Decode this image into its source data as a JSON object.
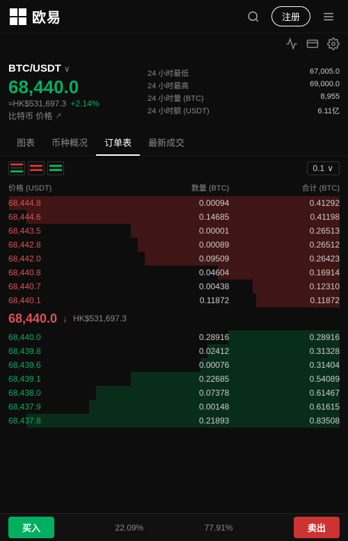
{
  "header": {
    "logo_text": "欧易",
    "register_label": "注册",
    "tabs": [
      "图表",
      "币种概况",
      "订单表",
      "最新成交"
    ],
    "active_tab": "订单表"
  },
  "pair": {
    "name": "BTC/USDT",
    "big_price": "68,440.0",
    "hk_price": "≈HK$531,697.3",
    "change": "+2.14%",
    "coin_label": "比特币 价格"
  },
  "stats": [
    {
      "label": "24 小时最低",
      "value": "67,005.0"
    },
    {
      "label": "24 小时最高",
      "value": "69,000.0"
    },
    {
      "label": "24 小时量 (BTC)",
      "value": "8,955"
    },
    {
      "label": "24 小时额 (USDT)",
      "value": "6.11亿"
    }
  ],
  "orderbook": {
    "decimal_selector": "0.1",
    "header": [
      "价格 (USDT)",
      "数量 (BTC)",
      "合计 (BTC)"
    ],
    "asks": [
      {
        "price": "68,444.8",
        "qty": "0.00094",
        "total": "0.41292",
        "bar_pct": 95
      },
      {
        "price": "68,444.6",
        "qty": "0.14685",
        "total": "0.41198",
        "bar_pct": 90
      },
      {
        "price": "68,443.5",
        "qty": "0.00001",
        "total": "0.26513",
        "bar_pct": 60
      },
      {
        "price": "68,442.8",
        "qty": "0.00089",
        "total": "0.26512",
        "bar_pct": 58
      },
      {
        "price": "68,442.0",
        "qty": "0.09509",
        "total": "0.26423",
        "bar_pct": 56
      },
      {
        "price": "68,440.8",
        "qty": "0.04604",
        "total": "0.16914",
        "bar_pct": 35
      },
      {
        "price": "68,440.7",
        "qty": "0.00438",
        "total": "0.12310",
        "bar_pct": 25
      },
      {
        "price": "68,440.1",
        "qty": "0.11872",
        "total": "0.11872",
        "bar_pct": 24
      }
    ],
    "mid_price": "68,440.0",
    "mid_arrow": "↓",
    "mid_hk": "HK$531,697.3",
    "bids": [
      {
        "price": "68,440.0",
        "qty": "0.28916",
        "total": "0.28916",
        "bar_pct": 32
      },
      {
        "price": "68,439.8",
        "qty": "0.02412",
        "total": "0.31328",
        "bar_pct": 38
      },
      {
        "price": "68,439.6",
        "qty": "0.00076",
        "total": "0.31404",
        "bar_pct": 40
      },
      {
        "price": "68,439.1",
        "qty": "0.22685",
        "total": "0.54089",
        "bar_pct": 60
      },
      {
        "price": "68,438.0",
        "qty": "0.07378",
        "total": "0.61467",
        "bar_pct": 70
      },
      {
        "price": "68,437.9",
        "qty": "0.00148",
        "total": "0.61615",
        "bar_pct": 72
      },
      {
        "price": "68,437.8",
        "qty": "0.21893",
        "total": "0.83508",
        "bar_pct": 90
      }
    ]
  },
  "bottom_bar": {
    "buy_label": "买入",
    "sell_label": "卖出",
    "pct_buy": "22.09%",
    "pct_sell": "77.91%"
  }
}
